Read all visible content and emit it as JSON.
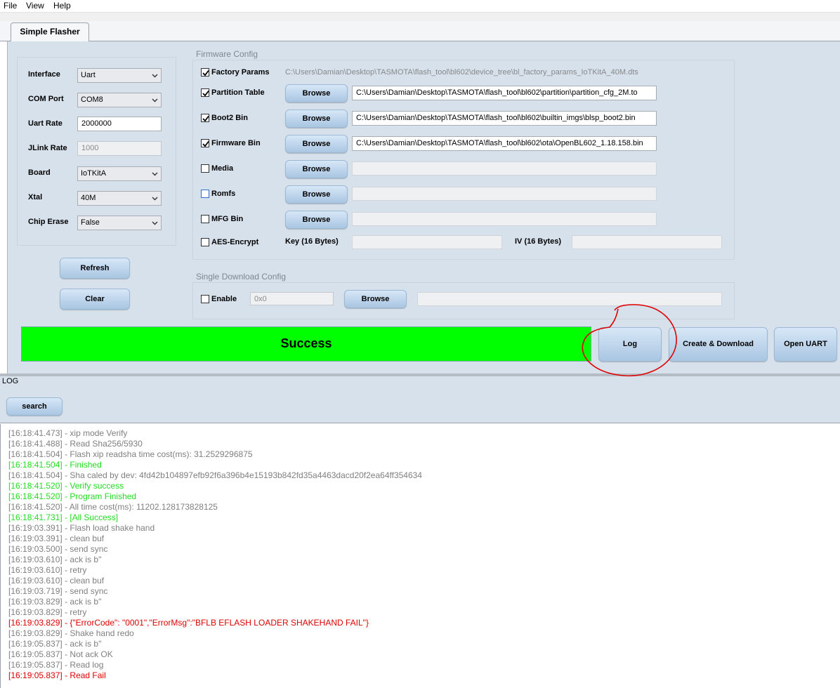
{
  "menu": [
    "File",
    "View",
    "Help"
  ],
  "tab": "Simple Flasher",
  "left": {
    "interface": {
      "label": "Interface",
      "value": "Uart"
    },
    "com_port": {
      "label": "COM Port",
      "value": "COM8"
    },
    "uart_rate": {
      "label": "Uart Rate",
      "value": "2000000"
    },
    "jlink_rate": {
      "label": "JLink Rate",
      "value": "1000"
    },
    "board": {
      "label": "Board",
      "value": "IoTKitA"
    },
    "xtal": {
      "label": "Xtal",
      "value": "40M"
    },
    "chip_erase": {
      "label": "Chip Erase",
      "value": "False"
    },
    "refresh_label": "Refresh",
    "clear_label": "Clear"
  },
  "firmware": {
    "group_label": "Firmware Config",
    "factory_params": {
      "label": "Factory Params",
      "checked": true,
      "path": "C:\\Users\\Damian\\Desktop\\TASMOTA\\flash_tool\\bl602\\device_tree\\bl_factory_params_IoTKitA_40M.dts"
    },
    "partition_table": {
      "label": "Partition Table",
      "checked": true,
      "path": "C:\\Users\\Damian\\Desktop\\TASMOTA\\flash_tool\\bl602\\partition\\partition_cfg_2M.to"
    },
    "boot2_bin": {
      "label": "Boot2 Bin",
      "checked": true,
      "path": "C:\\Users\\Damian\\Desktop\\TASMOTA\\flash_tool\\bl602\\builtin_imgs\\blsp_boot2.bin"
    },
    "firmware_bin": {
      "label": "Firmware Bin",
      "checked": true,
      "path": "C:\\Users\\Damian\\Desktop\\TASMOTA\\flash_tool\\bl602\\ota\\OpenBL602_1.18.158.bin"
    },
    "media": {
      "label": "Media",
      "checked": false
    },
    "romfs": {
      "label": "Romfs",
      "checked": false
    },
    "mfg_bin": {
      "label": "MFG Bin",
      "checked": false
    },
    "aes": {
      "label": "AES-Encrypt",
      "checked": false,
      "key_label": "Key (16 Bytes)",
      "iv_label": "IV (16 Bytes)"
    },
    "browse_label": "Browse"
  },
  "single": {
    "group_label": "Single Download Config",
    "enable_label": "Enable",
    "address": "0x0",
    "browse_label": "Browse"
  },
  "status": {
    "text": "Success",
    "color": "#00ff00"
  },
  "actions": {
    "log": "Log",
    "create_download": "Create & Download",
    "open_uart": "Open UART"
  },
  "log": {
    "title": "LOG",
    "search_label": "search",
    "lines": [
      {
        "text": "[16:18:41.473] - xip mode Verify",
        "color": "#808080"
      },
      {
        "text": "[16:18:41.488] - Read Sha256/5930",
        "color": "#808080"
      },
      {
        "text": "[16:18:41.504] - Flash xip readsha time cost(ms): 31.2529296875",
        "color": "#808080"
      },
      {
        "text": "[16:18:41.504] - Finished",
        "color": "#22dd22"
      },
      {
        "text": "[16:18:41.504] - Sha caled by dev: 4fd42b104897efb92f6a396b4e15193b842fd35a4463dacd20f2ea64ff354634",
        "color": "#808080"
      },
      {
        "text": "[16:18:41.520] - Verify success",
        "color": "#22dd22"
      },
      {
        "text": "[16:18:41.520] - Program Finished",
        "color": "#22dd22"
      },
      {
        "text": "[16:18:41.520] - All time cost(ms): 11202.128173828125",
        "color": "#808080"
      },
      {
        "text": "[16:18:41.731] - [All Success]",
        "color": "#22dd22"
      },
      {
        "text": "[16:19:03.391] - Flash load shake hand",
        "color": "#808080"
      },
      {
        "text": "[16:19:03.391] - clean buf",
        "color": "#808080"
      },
      {
        "text": "[16:19:03.500] - send sync",
        "color": "#808080"
      },
      {
        "text": "[16:19:03.610] - ack is b''",
        "color": "#808080"
      },
      {
        "text": "[16:19:03.610] - retry",
        "color": "#808080"
      },
      {
        "text": "[16:19:03.610] - clean buf",
        "color": "#808080"
      },
      {
        "text": "[16:19:03.719] - send sync",
        "color": "#808080"
      },
      {
        "text": "[16:19:03.829] - ack is b''",
        "color": "#808080"
      },
      {
        "text": "[16:19:03.829] - retry",
        "color": "#808080"
      },
      {
        "text": "[16:19:03.829] - {\"ErrorCode\": \"0001\",\"ErrorMsg\":\"BFLB EFLASH LOADER SHAKEHAND FAIL\"}",
        "color": "#e00000"
      },
      {
        "text": "[16:19:03.829] - Shake hand redo",
        "color": "#808080"
      },
      {
        "text": "[16:19:05.837] - ack is b''",
        "color": "#808080"
      },
      {
        "text": "[16:19:05.837] - Not ack OK",
        "color": "#808080"
      },
      {
        "text": "[16:19:05.837] - Read log",
        "color": "#808080"
      },
      {
        "text": "[16:19:05.837] - Read Fail",
        "color": "#e00000"
      }
    ]
  },
  "annotation_color": "#e00000"
}
